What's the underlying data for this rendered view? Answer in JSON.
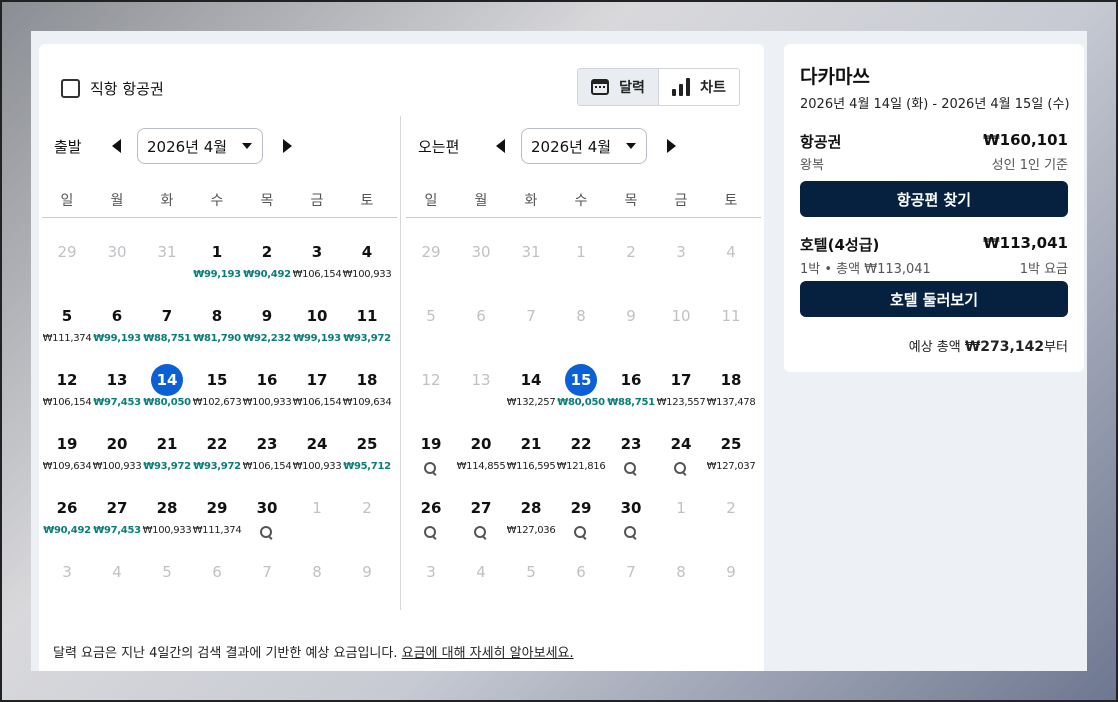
{
  "filter": {
    "direct_label": "직항 항공권"
  },
  "view_toggle": {
    "calendar_label": "달력",
    "chart_label": "차트"
  },
  "weekdays": [
    "일",
    "월",
    "화",
    "수",
    "목",
    "금",
    "토"
  ],
  "departure": {
    "label": "출발",
    "month": "2026년 4월",
    "days": [
      {
        "d": "29",
        "dim": true
      },
      {
        "d": "30",
        "dim": true
      },
      {
        "d": "31",
        "dim": true
      },
      {
        "d": "1",
        "p": "₩99,193",
        "c": true
      },
      {
        "d": "2",
        "p": "₩90,492",
        "c": true
      },
      {
        "d": "3",
        "p": "₩106,154"
      },
      {
        "d": "4",
        "p": "₩100,933"
      },
      {
        "d": "5",
        "p": "₩111,374"
      },
      {
        "d": "6",
        "p": "₩99,193",
        "c": true
      },
      {
        "d": "7",
        "p": "₩88,751",
        "c": true
      },
      {
        "d": "8",
        "p": "₩81,790",
        "c": true
      },
      {
        "d": "9",
        "p": "₩92,232",
        "c": true
      },
      {
        "d": "10",
        "p": "₩99,193",
        "c": true
      },
      {
        "d": "11",
        "p": "₩93,972",
        "c": true
      },
      {
        "d": "12",
        "p": "₩106,154"
      },
      {
        "d": "13",
        "p": "₩97,453",
        "c": true
      },
      {
        "d": "14",
        "p": "₩80,050",
        "c": true,
        "sel": true
      },
      {
        "d": "15",
        "p": "₩102,673"
      },
      {
        "d": "16",
        "p": "₩100,933"
      },
      {
        "d": "17",
        "p": "₩106,154"
      },
      {
        "d": "18",
        "p": "₩109,634"
      },
      {
        "d": "19",
        "p": "₩109,634"
      },
      {
        "d": "20",
        "p": "₩100,933"
      },
      {
        "d": "21",
        "p": "₩93,972",
        "c": true
      },
      {
        "d": "22",
        "p": "₩93,972",
        "c": true
      },
      {
        "d": "23",
        "p": "₩106,154"
      },
      {
        "d": "24",
        "p": "₩100,933"
      },
      {
        "d": "25",
        "p": "₩95,712",
        "c": true
      },
      {
        "d": "26",
        "p": "₩90,492",
        "c": true
      },
      {
        "d": "27",
        "p": "₩97,453",
        "c": true
      },
      {
        "d": "28",
        "p": "₩100,933"
      },
      {
        "d": "29",
        "p": "₩111,374"
      },
      {
        "d": "30",
        "s": true
      },
      {
        "d": "1",
        "dim": true
      },
      {
        "d": "2",
        "dim": true
      },
      {
        "d": "3",
        "dim": true
      },
      {
        "d": "4",
        "dim": true
      },
      {
        "d": "5",
        "dim": true
      },
      {
        "d": "6",
        "dim": true
      },
      {
        "d": "7",
        "dim": true
      },
      {
        "d": "8",
        "dim": true
      },
      {
        "d": "9",
        "dim": true
      }
    ]
  },
  "return": {
    "label": "오는편",
    "month": "2026년 4월",
    "days": [
      {
        "d": "29",
        "dim": true
      },
      {
        "d": "30",
        "dim": true
      },
      {
        "d": "31",
        "dim": true
      },
      {
        "d": "1",
        "dim": true
      },
      {
        "d": "2",
        "dim": true
      },
      {
        "d": "3",
        "dim": true
      },
      {
        "d": "4",
        "dim": true
      },
      {
        "d": "5",
        "dim": true
      },
      {
        "d": "6",
        "dim": true
      },
      {
        "d": "7",
        "dim": true
      },
      {
        "d": "8",
        "dim": true
      },
      {
        "d": "9",
        "dim": true
      },
      {
        "d": "10",
        "dim": true
      },
      {
        "d": "11",
        "dim": true
      },
      {
        "d": "12",
        "dim": true
      },
      {
        "d": "13",
        "dim": true
      },
      {
        "d": "14",
        "p": "₩132,257"
      },
      {
        "d": "15",
        "p": "₩80,050",
        "c": true,
        "sel": true
      },
      {
        "d": "16",
        "p": "₩88,751",
        "c": true
      },
      {
        "d": "17",
        "p": "₩123,557"
      },
      {
        "d": "18",
        "p": "₩137,478"
      },
      {
        "d": "19",
        "s": true
      },
      {
        "d": "20",
        "p": "₩114,855"
      },
      {
        "d": "21",
        "p": "₩116,595"
      },
      {
        "d": "22",
        "p": "₩121,816"
      },
      {
        "d": "23",
        "s": true
      },
      {
        "d": "24",
        "s": true
      },
      {
        "d": "25",
        "p": "₩127,037"
      },
      {
        "d": "26",
        "s": true
      },
      {
        "d": "27",
        "s": true
      },
      {
        "d": "28",
        "p": "₩127,036"
      },
      {
        "d": "29",
        "s": true
      },
      {
        "d": "30",
        "s": true
      },
      {
        "d": "1",
        "dim": true
      },
      {
        "d": "2",
        "dim": true
      },
      {
        "d": "3",
        "dim": true
      },
      {
        "d": "4",
        "dim": true
      },
      {
        "d": "5",
        "dim": true
      },
      {
        "d": "6",
        "dim": true
      },
      {
        "d": "7",
        "dim": true
      },
      {
        "d": "8",
        "dim": true
      },
      {
        "d": "9",
        "dim": true
      }
    ]
  },
  "footnote": {
    "text": "달력 요금은 지난 4일간의 검색 결과에 기반한 예상 요금입니다. ",
    "link": "요금에 대해 자세히 알아보세요."
  },
  "summary": {
    "destination": "다카마쓰",
    "dates": "2026년 4월 14일 (화) - 2026년 4월 15일 (수)",
    "flight_label": "항공권",
    "flight_price": "₩160,101",
    "flight_type": "왕복",
    "flight_basis": "성인 1인 기준",
    "flight_button": "항공편 찾기",
    "hotel_label": "호텔(4성급)",
    "hotel_price": "₩113,041",
    "hotel_detail": "1박 • 총액 ₩113,041",
    "hotel_basis": "1박 요금",
    "hotel_button": "호텔 둘러보기",
    "total_prefix": "예상 총액 ",
    "total_amount": "₩273,142",
    "total_suffix": "부터"
  }
}
